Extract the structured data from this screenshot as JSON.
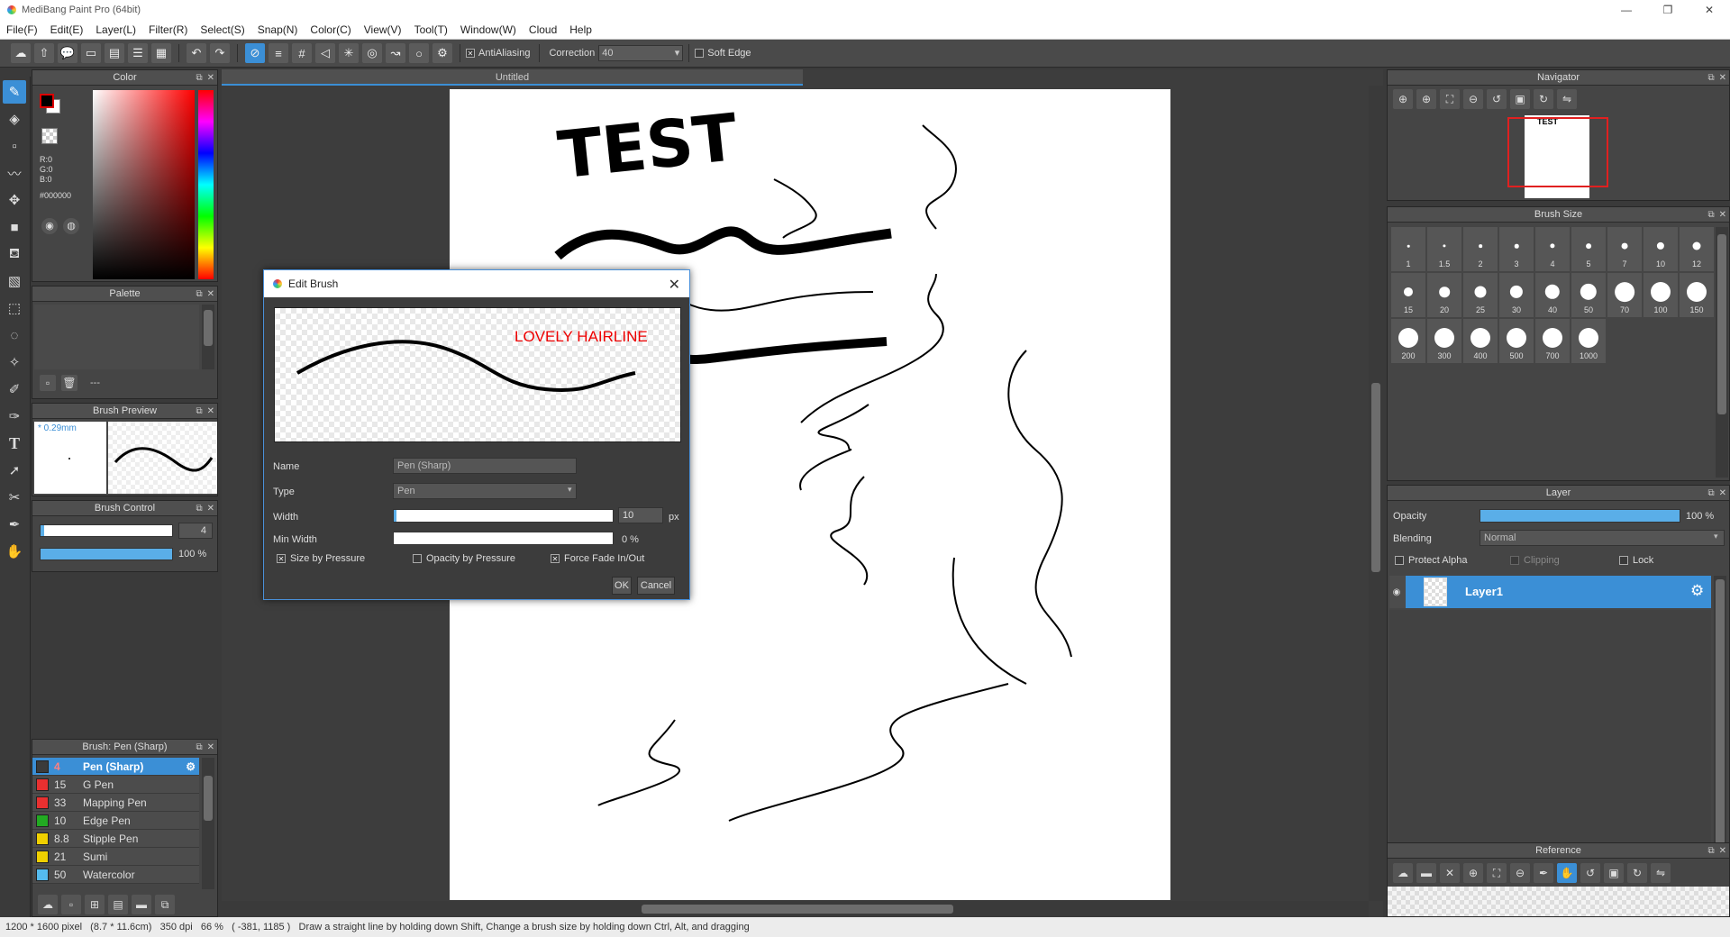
{
  "window": {
    "title": "MediBang Paint Pro (64bit)",
    "minimize": "—",
    "maximize": "❐",
    "close": "✕"
  },
  "menu": [
    "File(F)",
    "Edit(E)",
    "Layer(L)",
    "Filter(R)",
    "Select(S)",
    "Snap(N)",
    "Color(C)",
    "View(V)",
    "Tool(T)",
    "Window(W)",
    "Cloud",
    "Help"
  ],
  "toolbar": {
    "antialiasing": "AntiAliasing",
    "correction_label": "Correction",
    "correction_value": "40",
    "soft_edge": "Soft Edge"
  },
  "color_panel": {
    "title": "Color",
    "r": "R:0",
    "g": "G:0",
    "b": "B:0",
    "hex": "#000000"
  },
  "palette_panel": {
    "title": "Palette",
    "value": "---"
  },
  "brush_preview": {
    "title": "Brush Preview",
    "size": "* 0.29mm"
  },
  "brush_control": {
    "title": "Brush Control",
    "size_value": "4",
    "opacity": "100 %"
  },
  "brush_list": {
    "title": "Brush: Pen (Sharp)",
    "items": [
      {
        "size": "4",
        "name": "Pen (Sharp)",
        "color": "#3b3b3b",
        "selected": true
      },
      {
        "size": "15",
        "name": "G Pen",
        "color": "#e83030"
      },
      {
        "size": "33",
        "name": "Mapping Pen",
        "color": "#e83030"
      },
      {
        "size": "10",
        "name": "Edge Pen",
        "color": "#22aa22"
      },
      {
        "size": "8.8",
        "name": "Stipple Pen",
        "color": "#f0d000"
      },
      {
        "size": "21",
        "name": "Sumi",
        "color": "#f0d000"
      },
      {
        "size": "50",
        "name": "Watercolor",
        "color": "#55bbee"
      }
    ]
  },
  "canvas": {
    "tab_title": "Untitled",
    "drawing_text": "TEST"
  },
  "dialog": {
    "title": "Edit Brush",
    "preview_text": "LOVELY HAIRLINE",
    "name_label": "Name",
    "name_value": "Pen (Sharp)",
    "type_label": "Type",
    "type_value": "Pen",
    "width_label": "Width",
    "width_value": "10",
    "width_unit": "px",
    "min_width_label": "Min Width",
    "min_width_value": "0 %",
    "size_by_pressure": "Size by Pressure",
    "opacity_by_pressure": "Opacity by Pressure",
    "force_fade": "Force Fade In/Out",
    "ok": "OK",
    "cancel": "Cancel"
  },
  "navigator": {
    "title": "Navigator"
  },
  "brush_size": {
    "title": "Brush Size",
    "sizes": [
      "1",
      "1.5",
      "2",
      "3",
      "4",
      "5",
      "7",
      "10",
      "12",
      "15",
      "20",
      "25",
      "30",
      "40",
      "50",
      "70",
      "100",
      "150",
      "200",
      "300",
      "400",
      "500",
      "700",
      "1000"
    ]
  },
  "layer_panel": {
    "title": "Layer",
    "opacity_label": "Opacity",
    "opacity_value": "100 %",
    "blending_label": "Blending",
    "blending_value": "Normal",
    "protect_alpha": "Protect Alpha",
    "clipping": "Clipping",
    "lock": "Lock",
    "layer_name": "Layer1"
  },
  "reference": {
    "title": "Reference"
  },
  "status": {
    "text": "1200 * 1600 pixel   (8.7 * 11.6cm)   350 dpi   66 %   ( -381, 1185 )   Draw a straight line by holding down Shift, Change a brush size by holding down Ctrl, Alt, and dragging"
  }
}
